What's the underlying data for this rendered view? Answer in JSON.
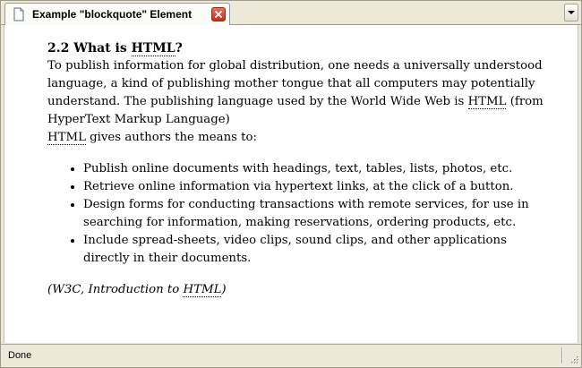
{
  "tab": {
    "title": "Example \"blockquote\" Element",
    "favicon_icon": "page-icon",
    "close_icon": "close-icon",
    "list_icon": "chevron-down-icon"
  },
  "article": {
    "heading_number": "2.2 What is ",
    "heading_abbr": "HTML",
    "heading_suffix": "?",
    "p1_text": "To publish information for global distribution, one needs a universally understood language, a kind of publishing mother tongue that all computers may potentially understand. The publishing language used by the World Wide Web is ",
    "p1_abbr": "HTML",
    "p1_tail": " (from HyperText Markup Language)",
    "p2_abbr": "HTML",
    "p2_text": " gives authors the means to:",
    "bullets": [
      "Publish online documents with headings, text, tables, lists, photos, etc.",
      "Retrieve online information via hypertext links, at the click of a button.",
      "Design forms for conducting transactions with remote services, for use in searching for information, making reservations, ordering products, etc.",
      "Include spread-sheets, video clips, sound clips, and other applications directly in their documents."
    ],
    "cite_prefix": "(W3C, Introduction to ",
    "cite_abbr": "HTML",
    "cite_suffix": ")"
  },
  "status": {
    "text": "Done"
  },
  "colors": {
    "close_button": "#c0311b",
    "chrome": "#ece9d8"
  }
}
